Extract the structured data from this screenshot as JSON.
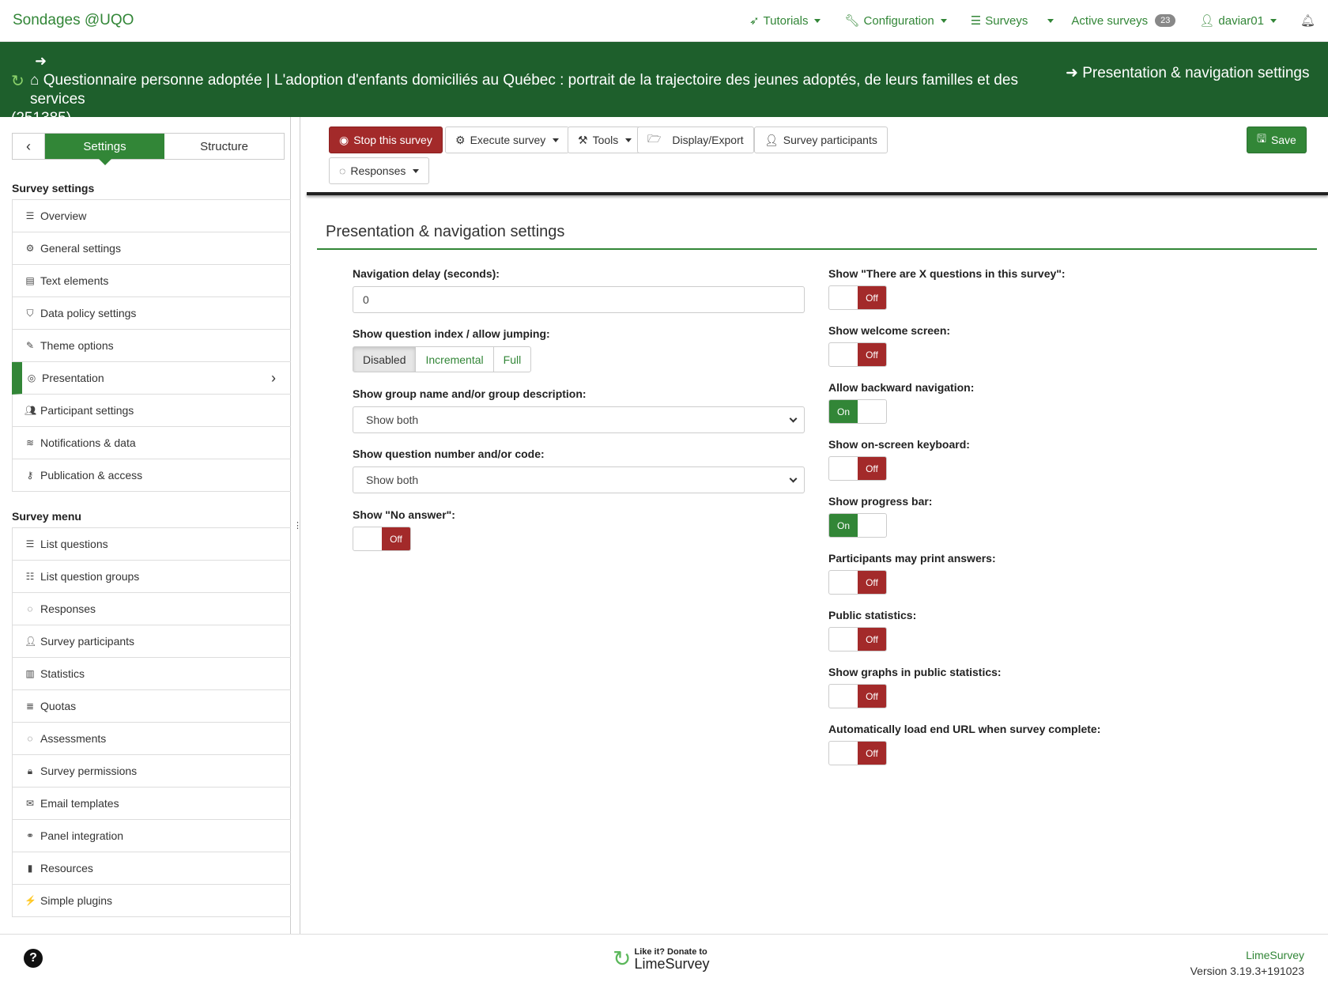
{
  "topnav": {
    "brand": "Sondages @UQO",
    "items": [
      {
        "icon": "rocket-icon",
        "label": "Tutorials"
      },
      {
        "icon": "wrench-icon",
        "label": "Configuration"
      },
      {
        "icon": "list-icon",
        "label": "Surveys"
      },
      {
        "label": "Active surveys",
        "badge": "23"
      },
      {
        "icon": "user-icon",
        "label": "daviar01"
      }
    ]
  },
  "banner": {
    "title": "Questionnaire personne adoptée | L'adoption d'enfants domiciliés au Québec : portrait de la trajectoire des jeunes adoptés, de leurs familles et des services",
    "survey_id": "(251385)",
    "breadcrumb": "Presentation & navigation settings"
  },
  "sidebar": {
    "tabs": {
      "settings": "Settings",
      "structure": "Structure"
    },
    "settings_header": "Survey settings",
    "settings_items": [
      {
        "icon": "list-icon",
        "label": "Overview"
      },
      {
        "icon": "cogs-icon",
        "label": "General settings"
      },
      {
        "icon": "file-text-icon",
        "label": "Text elements"
      },
      {
        "icon": "shield-icon",
        "label": "Data policy settings"
      },
      {
        "icon": "paint-brush-icon",
        "label": "Theme options"
      },
      {
        "icon": "eye-slash-icon",
        "label": "Presentation"
      },
      {
        "icon": "users-icon",
        "label": "Participant settings"
      },
      {
        "icon": "rss-icon",
        "label": "Notifications & data"
      },
      {
        "icon": "key-icon",
        "label": "Publication & access"
      }
    ],
    "menu_header": "Survey menu",
    "menu_items": [
      {
        "icon": "list-icon",
        "label": "List questions"
      },
      {
        "icon": "th-list-icon",
        "label": "List question groups"
      },
      {
        "icon": "comment-icon",
        "label": "Responses"
      },
      {
        "icon": "user-icon",
        "label": "Survey participants"
      },
      {
        "icon": "bar-chart-icon",
        "label": "Statistics"
      },
      {
        "icon": "tasks-icon",
        "label": "Quotas"
      },
      {
        "icon": "comments-icon",
        "label": "Assessments"
      },
      {
        "icon": "lock-icon",
        "label": "Survey permissions"
      },
      {
        "icon": "envelope-icon",
        "label": "Email templates"
      },
      {
        "icon": "link-icon",
        "label": "Panel integration"
      },
      {
        "icon": "file-icon",
        "label": "Resources"
      },
      {
        "icon": "plug-icon",
        "label": "Simple plugins"
      }
    ]
  },
  "toolbar": {
    "stop": "Stop this survey",
    "execute": "Execute survey",
    "tools": "Tools",
    "display": "Display/Export",
    "participants": "Survey participants",
    "responses": "Responses",
    "save": "Save"
  },
  "page": {
    "title": "Presentation & navigation settings",
    "nav_delay_label": "Navigation delay (seconds):",
    "nav_delay_value": "0",
    "qindex_label": "Show question index / allow jumping:",
    "qindex_options": [
      "Disabled",
      "Incremental",
      "Full"
    ],
    "qindex_selected": "Disabled",
    "group_label": "Show group name and/or group description:",
    "group_value": "Show both",
    "qnum_label": "Show question number and/or code:",
    "qnum_value": "Show both",
    "noanswer_label": "Show \"No answer\":",
    "noanswer_state": "Off",
    "toggles": [
      {
        "label": "Show \"There are X questions in this survey\":",
        "state": "Off"
      },
      {
        "label": "Show welcome screen:",
        "state": "Off"
      },
      {
        "label": "Allow backward navigation:",
        "state": "On"
      },
      {
        "label": "Show on-screen keyboard:",
        "state": "Off"
      },
      {
        "label": "Show progress bar:",
        "state": "On"
      },
      {
        "label": "Participants may print answers:",
        "state": "Off"
      },
      {
        "label": "Public statistics:",
        "state": "Off"
      },
      {
        "label": "Show graphs in public statistics:",
        "state": "Off"
      },
      {
        "label": "Automatically load end URL when survey complete:",
        "state": "Off"
      }
    ]
  },
  "footer": {
    "donate_line1": "Like it? Donate to",
    "donate_line2": "LimeSurvey",
    "product": "LimeSurvey",
    "version": "Version 3.19.3+191023"
  },
  "colors": {
    "brand": "#328637",
    "banner": "#1e5f2c",
    "danger": "#a32a2a"
  }
}
